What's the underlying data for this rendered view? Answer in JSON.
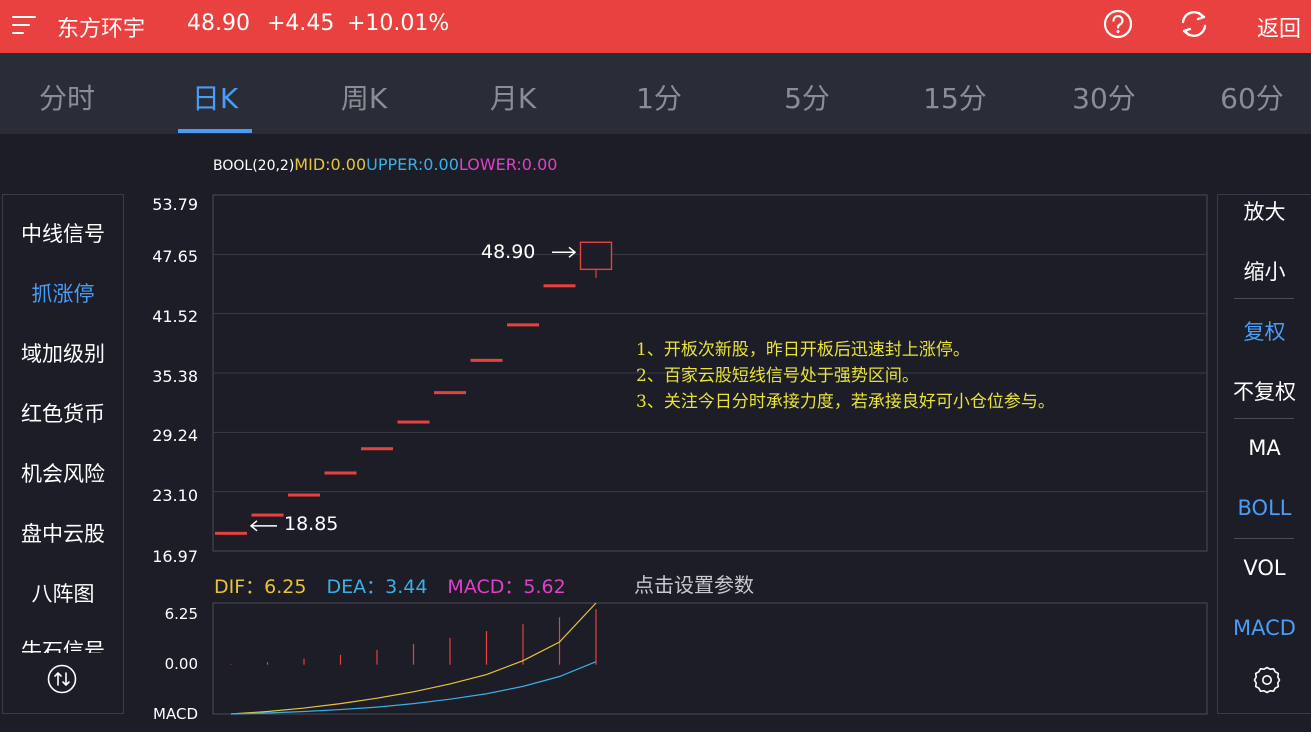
{
  "header": {
    "stock_name": "东方环宇",
    "price": "48.90",
    "change": "+4.45",
    "change_pct": "+10.01%",
    "back_label": "返回",
    "help_icon": "question-circle-icon",
    "refresh_icon": "refresh-icon",
    "menu_icon": "menu-icon"
  },
  "tabs": [
    {
      "label": "分时",
      "active": false
    },
    {
      "label": "日K",
      "active": true
    },
    {
      "label": "周K",
      "active": false
    },
    {
      "label": "月K",
      "active": false
    },
    {
      "label": "1分",
      "active": false
    },
    {
      "label": "5分",
      "active": false
    },
    {
      "label": "15分",
      "active": false
    },
    {
      "label": "30分",
      "active": false
    },
    {
      "label": "60分",
      "active": false
    }
  ],
  "boll": {
    "name": "BOOL(20,2)",
    "mid": "MID:0.00",
    "upper": "UPPER:0.00",
    "lower": "LOWER:0.00"
  },
  "left_panel": {
    "items": [
      {
        "label": "中线信号",
        "active": false
      },
      {
        "label": "抓涨停",
        "active": true
      },
      {
        "label": "域加级别",
        "active": false
      },
      {
        "label": "红色货币",
        "active": false
      },
      {
        "label": "机会风险",
        "active": false
      },
      {
        "label": "盘中云股",
        "active": false
      },
      {
        "label": "八阵图",
        "active": false
      },
      {
        "label": "牛石信号",
        "active": false
      }
    ],
    "scroll_icon": "up-down-arrows-icon"
  },
  "right_panel": {
    "items": [
      {
        "label": "放大",
        "active": false
      },
      {
        "label": "缩小",
        "active": false
      },
      {
        "label": "复权",
        "active": true
      },
      {
        "label": "不复权",
        "active": false
      },
      {
        "label": "MA",
        "active": false
      },
      {
        "label": "BOLL",
        "active": true
      },
      {
        "label": "VOL",
        "active": false
      },
      {
        "label": "MACD",
        "active": true
      }
    ],
    "settings_icon": "gear-icon"
  },
  "price_axis": [
    "53.79",
    "47.65",
    "41.52",
    "35.38",
    "29.24",
    "23.10",
    "16.97"
  ],
  "annotations": {
    "high_label": "48.90",
    "low_label": "18.85"
  },
  "notes": [
    "1、开板次新股，昨日开板后迅速封上涨停。",
    "2、百家云股短线信号处于强势区间。",
    "3、关注今日分时承接力度，若承接良好可小仓位参与。"
  ],
  "macd": {
    "dif": "DIF：6.25",
    "dea": "DEA：3.44",
    "macd": "MACD：5.62",
    "settings_link": "点击设置参数",
    "axis": [
      "6.25",
      "0.00",
      "MACD"
    ]
  },
  "colors": {
    "up": "#e8413f",
    "accent": "#4a9cf5",
    "dif": "#e8c33a",
    "dea": "#3ab0e8",
    "macd": "#e040c8",
    "note": "#e8e23a"
  },
  "chart_data": {
    "type": "candlestick",
    "ylim": [
      16.97,
      53.79
    ],
    "candles": [
      {
        "open": 18.85,
        "close": 18.85,
        "high": 18.85,
        "low": 18.85
      },
      {
        "open": 20.74,
        "close": 20.74,
        "high": 20.74,
        "low": 20.74
      },
      {
        "open": 22.81,
        "close": 22.81,
        "high": 22.81,
        "low": 22.81
      },
      {
        "open": 25.09,
        "close": 25.09,
        "high": 25.09,
        "low": 25.09
      },
      {
        "open": 27.6,
        "close": 27.6,
        "high": 27.6,
        "low": 27.6
      },
      {
        "open": 30.36,
        "close": 30.36,
        "high": 30.36,
        "low": 30.36
      },
      {
        "open": 33.4,
        "close": 33.4,
        "high": 33.4,
        "low": 33.4
      },
      {
        "open": 36.74,
        "close": 36.74,
        "high": 36.74,
        "low": 36.74
      },
      {
        "open": 40.41,
        "close": 40.41,
        "high": 40.41,
        "low": 40.41
      },
      {
        "open": 44.45,
        "close": 44.45,
        "high": 44.45,
        "low": 44.45
      },
      {
        "open": 46.1,
        "close": 48.9,
        "high": 48.9,
        "low": 45.2
      }
    ],
    "macd_panel": {
      "ylim": [
        -5.0,
        6.25
      ],
      "histogram": [
        0.05,
        0.25,
        0.6,
        1.0,
        1.5,
        2.1,
        2.7,
        3.4,
        4.1,
        4.8,
        5.62
      ],
      "dif": [
        -5.0,
        -4.75,
        -4.4,
        -3.95,
        -3.4,
        -2.75,
        -1.95,
        -1.0,
        0.4,
        2.3,
        6.25
      ],
      "dea": [
        -5.0,
        -4.9,
        -4.75,
        -4.55,
        -4.3,
        -3.95,
        -3.5,
        -2.95,
        -2.2,
        -1.2,
        0.3
      ]
    }
  }
}
